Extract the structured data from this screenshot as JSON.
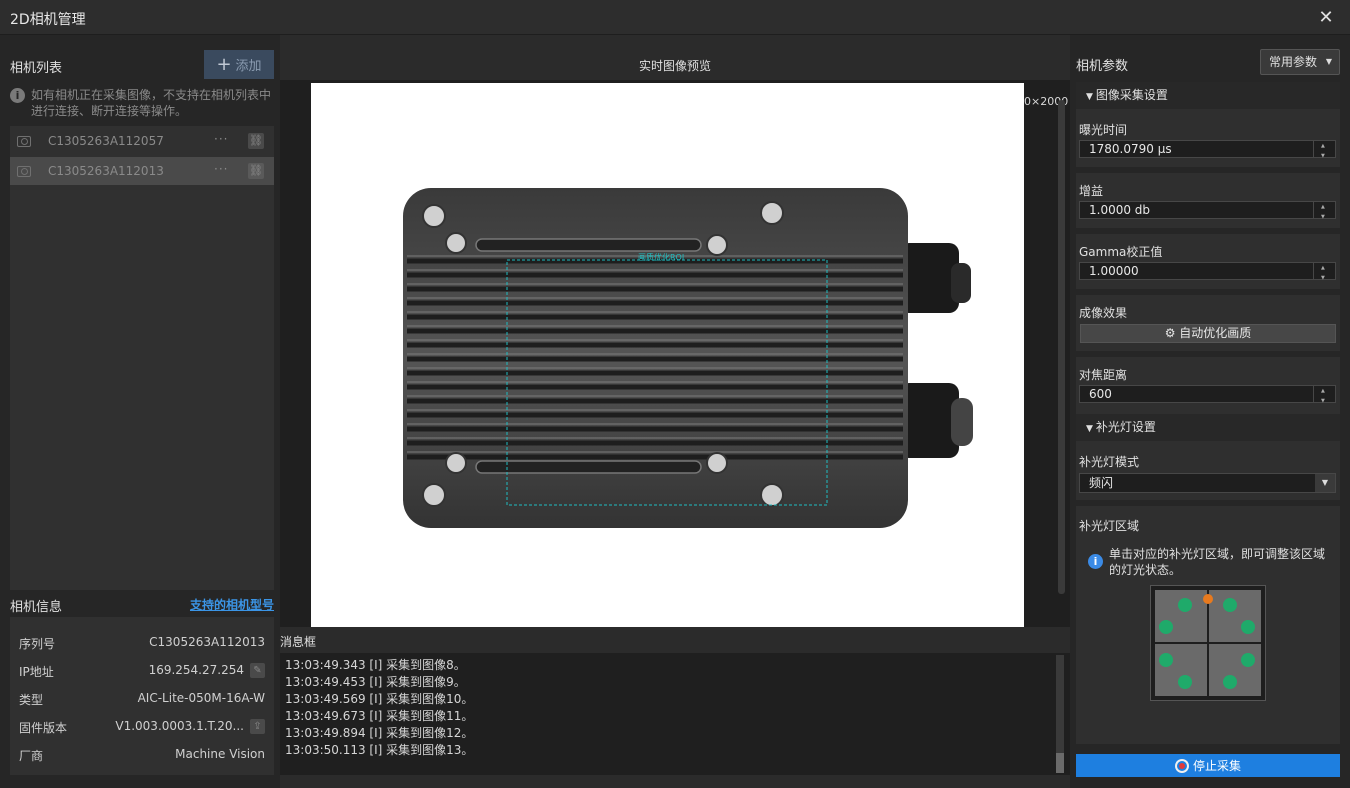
{
  "window": {
    "title": "2D相机管理"
  },
  "left": {
    "camera_list_title": "相机列表",
    "add_label": "添加",
    "hint": "如有相机正在采集图像，不支持在相机列表中进行连接、断开连接等操作。",
    "cameras": [
      {
        "serial": "C1305263A112057",
        "more": "···"
      },
      {
        "serial": "C1305263A112013",
        "more": "···"
      }
    ],
    "info_title": "相机信息",
    "supported_link": "支持的相机型号",
    "info": [
      {
        "key": "序列号",
        "value": "C1305263A112013"
      },
      {
        "key": "IP地址",
        "value": "169.254.27.254"
      },
      {
        "key": "类型",
        "value": "AIC-Lite-050M-16A-W"
      },
      {
        "key": "固件版本",
        "value": "V1.003.0003.1.T.20..."
      },
      {
        "key": "厂商",
        "value": "Machine Vision"
      }
    ]
  },
  "center": {
    "preview_title": "实时图像预览",
    "resolution": "0×2000",
    "roi_label": "画质优化ROI",
    "message_title": "消息框",
    "messages": [
      "13:03:49.343 [I] 采集到图像8。",
      "13:03:49.453 [I] 采集到图像9。",
      "13:03:49.569 [I] 采集到图像10。",
      "13:03:49.673 [I] 采集到图像11。",
      "13:03:49.894 [I] 采集到图像12。",
      "13:03:50.113 [I] 采集到图像13。"
    ]
  },
  "right": {
    "title": "相机参数",
    "preset": "常用参数",
    "image_group": "图像采集设置",
    "exposure_label": "曝光时间",
    "exposure_value": "1780.0790 μs",
    "gain_label": "增益",
    "gain_value": "1.0000 db",
    "gamma_label": "Gamma校正值",
    "gamma_value": "1.00000",
    "effect_label": "成像效果",
    "auto_btn": "自动优化画质",
    "focus_label": "对焦距离",
    "focus_value": "600",
    "light_group": "补光灯设置",
    "light_mode_label": "补光灯模式",
    "light_mode_value": "频闪",
    "light_zone_label": "补光灯区域",
    "light_hint": "单击对应的补光灯区域，即可调整该区域的灯光状态。",
    "stop_btn": "停止采集"
  },
  "colors": {
    "accent": "#1e7fe0",
    "link": "#3b95e6",
    "roi": "#1fbcc0",
    "light_on": "#1faa6a",
    "light_indicator": "#e87a1e"
  }
}
